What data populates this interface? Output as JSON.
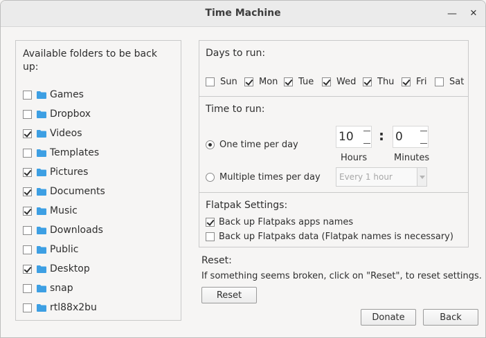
{
  "window": {
    "title": "Time Machine",
    "minimize_glyph": "—",
    "close_glyph": "✕"
  },
  "folders": {
    "title": "Available folders to be back up:",
    "items": [
      {
        "label": "Games",
        "checked": false
      },
      {
        "label": "Dropbox",
        "checked": false
      },
      {
        "label": "Videos",
        "checked": true
      },
      {
        "label": "Templates",
        "checked": false
      },
      {
        "label": "Pictures",
        "checked": true
      },
      {
        "label": "Documents",
        "checked": true
      },
      {
        "label": "Music",
        "checked": true
      },
      {
        "label": "Downloads",
        "checked": false
      },
      {
        "label": "Public",
        "checked": false
      },
      {
        "label": "Desktop",
        "checked": true
      },
      {
        "label": "snap",
        "checked": false
      },
      {
        "label": "rtl88x2bu",
        "checked": false
      }
    ],
    "folder_icon": "folder-icon",
    "folder_color": "#3d9fe3"
  },
  "days": {
    "title": "Days to run:",
    "items": [
      {
        "label": "Sun",
        "checked": false
      },
      {
        "label": "Mon",
        "checked": true
      },
      {
        "label": "Tue",
        "checked": true
      },
      {
        "label": "Wed",
        "checked": true
      },
      {
        "label": "Thu",
        "checked": true
      },
      {
        "label": "Fri",
        "checked": true
      },
      {
        "label": "Sat",
        "checked": false
      }
    ]
  },
  "time": {
    "title": "Time to run:",
    "one_time_label": "One time per day",
    "multiple_label": "Multiple times per day",
    "selected": "one",
    "hours_value": "10",
    "minutes_value": "0",
    "colon": ":",
    "hours_label": "Hours",
    "minutes_label": "Minutes",
    "interval_value": "Every 1 hour"
  },
  "flatpak": {
    "title": "Flatpak Settings:",
    "names_label": "Back up Flatpaks apps names",
    "names_checked": true,
    "data_label": "Back up Flatpaks data (Flatpak names is necessary)",
    "data_checked": false
  },
  "reset": {
    "title": "Reset:",
    "description": "If something seems broken, click on \"Reset\", to reset settings.",
    "button_label": "Reset"
  },
  "footer": {
    "donate_label": "Donate",
    "back_label": "Back"
  }
}
